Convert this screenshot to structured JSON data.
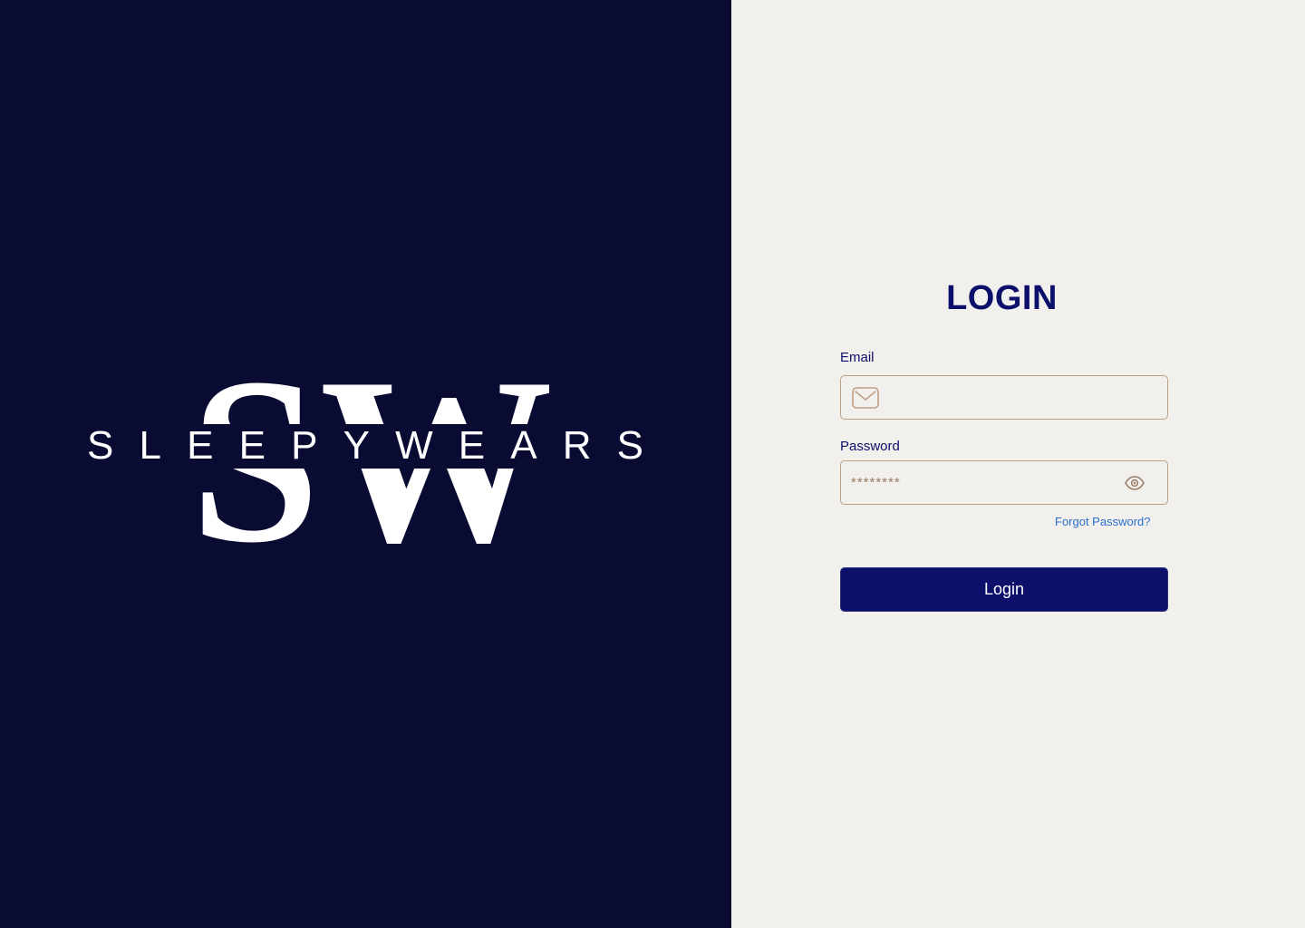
{
  "brand": {
    "monogram": "SW",
    "wordmark": "SLEEPYWEARS",
    "logo_icon": "sleepywears-logo",
    "colors": {
      "panel_bg": "#0a0b33",
      "logo_fg": "#ffffff"
    }
  },
  "login": {
    "title": "LOGIN",
    "email_label": "Email",
    "email_value": "",
    "email_icon": "mail-icon",
    "password_label": "Password",
    "password_placeholder": "********",
    "password_icon": "eye-icon",
    "forgot_password": "Forgot Password?",
    "submit_label": "Login",
    "colors": {
      "panel_bg": "#f1f0ed",
      "primary": "#0d106a",
      "field_border": "#c19f86",
      "link": "#2a6fd0"
    }
  }
}
